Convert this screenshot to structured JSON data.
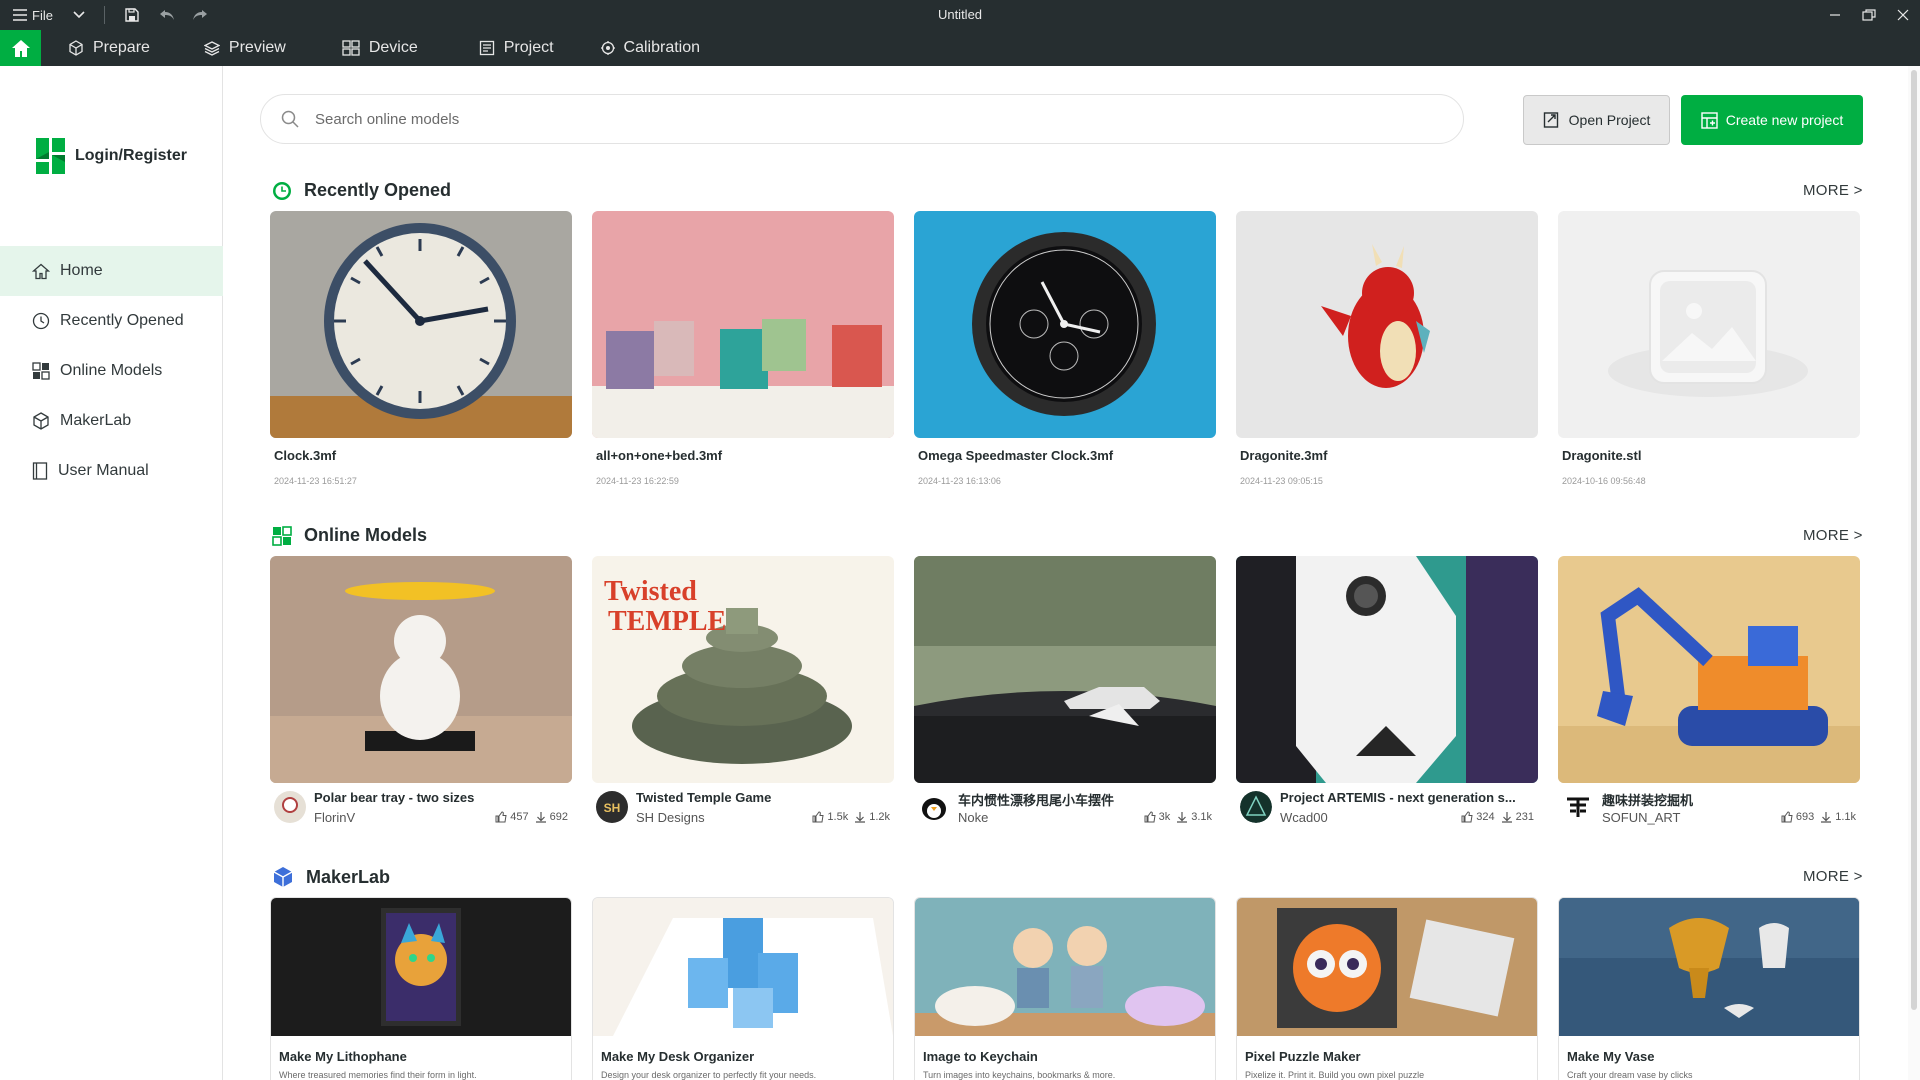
{
  "window": {
    "title": "Untitled",
    "file_label": "File"
  },
  "nav": {
    "tabs": [
      "Prepare",
      "Preview",
      "Device",
      "Project",
      "Calibration"
    ]
  },
  "sidebar": {
    "login_label": "Login/Register",
    "items": [
      "Home",
      "Recently Opened",
      "Online Models",
      "MakerLab",
      "User Manual"
    ],
    "active": "Home"
  },
  "search": {
    "placeholder": "Search online models"
  },
  "actions": {
    "open_project": "Open Project",
    "create_project": "Create new project"
  },
  "sections": {
    "recent": {
      "title": "Recently Opened",
      "more": "MORE >"
    },
    "online": {
      "title": "Online Models",
      "more": "MORE >"
    },
    "makerlab": {
      "title": "MakerLab",
      "more": "MORE >"
    }
  },
  "recent": [
    {
      "name": "Clock.3mf",
      "date": "2024-11-23 16:51:27"
    },
    {
      "name": "all+on+one+bed.3mf",
      "date": "2024-11-23 16:22:59"
    },
    {
      "name": "Omega Speedmaster Clock.3mf",
      "date": "2024-11-23 16:13:06"
    },
    {
      "name": "Dragonite.3mf",
      "date": "2024-11-23 09:05:15"
    },
    {
      "name": "Dragonite.stl",
      "date": "2024-10-16 09:56:48"
    }
  ],
  "online": [
    {
      "title": "Polar bear tray - two sizes",
      "author": "FlorinV",
      "likes": "457",
      "downloads": "692"
    },
    {
      "title": "Twisted Temple Game",
      "author": "SH Designs",
      "likes": "1.5k",
      "downloads": "1.2k"
    },
    {
      "title": "车内惯性漂移甩尾小车摆件",
      "author": "Noke",
      "likes": "3k",
      "downloads": "3.1k"
    },
    {
      "title": "Project ARTEMIS - next generation s...",
      "author": "Wcad00",
      "likes": "324",
      "downloads": "231"
    },
    {
      "title": "趣味拼装挖掘机",
      "author": "SOFUN_ART",
      "likes": "693",
      "downloads": "1.1k"
    }
  ],
  "makerlab": [
    {
      "title": "Make My Lithophane",
      "desc": "Where treasured memories find their form in light."
    },
    {
      "title": "Make My Desk Organizer",
      "desc": "Design your desk organizer to perfectly fit your needs."
    },
    {
      "title": "Image to Keychain",
      "desc": "Turn images into keychains, bookmarks & more."
    },
    {
      "title": "Pixel Puzzle Maker",
      "desc": "Pixelize it. Print it. Build you own pixel puzzle"
    },
    {
      "title": "Make My Vase",
      "desc": "Craft your dream vase by clicks"
    }
  ],
  "colors": {
    "accent": "#00ae42",
    "titlebar": "#262e30"
  },
  "icons": [
    "menu-icon",
    "chevron-down-icon",
    "save-icon",
    "undo-icon",
    "redo-icon",
    "home-icon",
    "cube-icon",
    "layers-icon",
    "device-icon",
    "project-icon",
    "calibration-icon",
    "search-icon",
    "clock-icon",
    "grid-icon",
    "makerlab-icon",
    "book-icon",
    "like-icon",
    "download-icon"
  ]
}
